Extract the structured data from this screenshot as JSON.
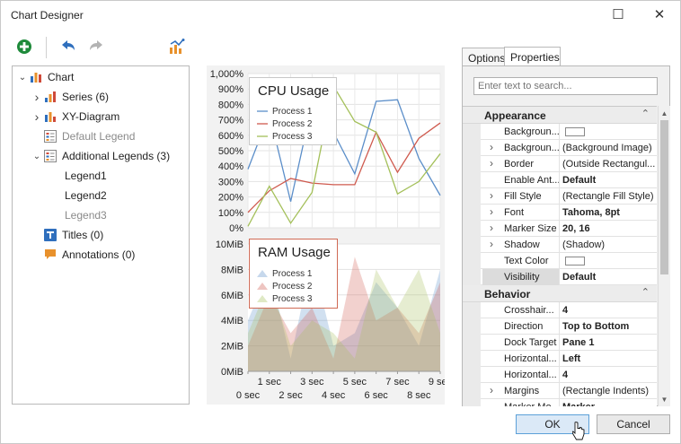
{
  "window": {
    "title": "Chart Designer",
    "maximize_glyph": "☐",
    "close_glyph": "✕"
  },
  "toolbar": {
    "add_icon": "plus-circle-icon",
    "undo_icon": "undo-icon",
    "redo_icon": "redo-icon",
    "chart_wizard_icon": "chart-wizard-icon"
  },
  "tree": {
    "items": [
      {
        "label": "Chart",
        "arrow": "⌄",
        "icon": "chart-icon"
      },
      {
        "label": "Series (6)",
        "arrow": "›",
        "icon": "series-icon"
      },
      {
        "label": "XY-Diagram",
        "arrow": "›",
        "icon": "diagram-icon"
      },
      {
        "label": "Default Legend",
        "arrow": "",
        "icon": "legend-icon"
      },
      {
        "label": "Additional Legends (3)",
        "arrow": "⌄",
        "icon": "legend-icon"
      },
      {
        "label": "Legend1",
        "arrow": "",
        "icon": ""
      },
      {
        "label": "Legend2",
        "arrow": "",
        "icon": ""
      },
      {
        "label": "Legend3",
        "arrow": "",
        "icon": ""
      },
      {
        "label": "Titles (0)",
        "arrow": "",
        "icon": "titles-icon"
      },
      {
        "label": "Annotations (0)",
        "arrow": "",
        "icon": "annotations-icon"
      }
    ]
  },
  "tabs": {
    "options": "Options",
    "properties": "Properties"
  },
  "search": {
    "placeholder": "Enter text to search..."
  },
  "properties": {
    "appearance_label": "Appearance",
    "behavior_label": "Behavior",
    "collapse_glyph": "⌃",
    "appearance_rows": [
      {
        "name": "Backgroun...",
        "value": "",
        "expander": "",
        "swatch": true,
        "bold": false
      },
      {
        "name": "Backgroun...",
        "value": "(Background Image)",
        "expander": "›",
        "swatch": false,
        "bold": false
      },
      {
        "name": "Border",
        "value": "(Outside Rectangul...",
        "expander": "›",
        "swatch": false,
        "bold": false
      },
      {
        "name": "Enable Ant...",
        "value": "Default",
        "expander": "",
        "swatch": false,
        "bold": true
      },
      {
        "name": "Fill Style",
        "value": "(Rectangle Fill Style)",
        "expander": "›",
        "swatch": false,
        "bold": false
      },
      {
        "name": "Font",
        "value": "Tahoma, 8pt",
        "expander": "›",
        "swatch": false,
        "bold": true
      },
      {
        "name": "Marker Size",
        "value": "20, 16",
        "expander": "›",
        "swatch": false,
        "bold": true
      },
      {
        "name": "Shadow",
        "value": "(Shadow)",
        "expander": "›",
        "swatch": false,
        "bold": false
      },
      {
        "name": "Text Color",
        "value": "",
        "expander": "",
        "swatch": true,
        "bold": false
      },
      {
        "name": "Visibility",
        "value": "Default",
        "expander": "",
        "swatch": false,
        "bold": true
      }
    ],
    "behavior_rows": [
      {
        "name": "Crosshair...",
        "value": "4",
        "expander": "",
        "swatch": false,
        "bold": true
      },
      {
        "name": "Direction",
        "value": "Top to Bottom",
        "expander": "",
        "swatch": false,
        "bold": true
      },
      {
        "name": "Dock Target",
        "value": "Pane 1",
        "expander": "",
        "swatch": false,
        "bold": true
      },
      {
        "name": "Horizontal...",
        "value": "Left",
        "expander": "",
        "swatch": false,
        "bold": true
      },
      {
        "name": "Horizontal...",
        "value": "4",
        "expander": "",
        "swatch": false,
        "bold": true
      },
      {
        "name": "Margins",
        "value": "(Rectangle Indents)",
        "expander": "›",
        "swatch": false,
        "bold": false
      },
      {
        "name": "Marker Mo...",
        "value": "Marker",
        "expander": "",
        "swatch": false,
        "bold": true
      }
    ]
  },
  "buttons": {
    "ok": "OK",
    "cancel": "Cancel"
  },
  "colors": {
    "process1": "#5b8ec9",
    "process2": "#cf5a4e",
    "process3": "#a4c05a",
    "accent": "#5ca0d8"
  },
  "chart_data": [
    {
      "type": "line",
      "title": "CPU Usage",
      "ylim": [
        0,
        1000
      ],
      "y_ticks": [
        "0%",
        "100%",
        "200%",
        "300%",
        "400%",
        "500%",
        "600%",
        "700%",
        "800%",
        "900%",
        "1,000%"
      ],
      "x": [
        0,
        1,
        2,
        3,
        4,
        5,
        6,
        7,
        8,
        9
      ],
      "series": [
        {
          "name": "Process 1",
          "values": [
            380,
            740,
            170,
            800,
            620,
            350,
            820,
            830,
            450,
            210
          ]
        },
        {
          "name": "Process 2",
          "values": [
            100,
            240,
            320,
            290,
            280,
            280,
            620,
            360,
            580,
            680
          ]
        },
        {
          "name": "Process 3",
          "values": [
            10,
            270,
            30,
            230,
            920,
            690,
            620,
            220,
            300,
            480
          ]
        }
      ]
    },
    {
      "type": "area",
      "title": "RAM Usage",
      "ylim": [
        0,
        10
      ],
      "y_ticks": [
        "0MiB",
        "2MiB",
        "4MiB",
        "6MiB",
        "8MiB",
        "10MiB"
      ],
      "x": [
        0,
        1,
        2,
        3,
        4,
        5,
        6,
        7,
        8,
        9
      ],
      "x_ticks_top": [
        "1 sec",
        "3 sec",
        "5 sec",
        "7 sec",
        "9 sec"
      ],
      "x_ticks_bottom": [
        "0 sec",
        "2 sec",
        "4 sec",
        "6 sec",
        "8 sec"
      ],
      "series": [
        {
          "name": "Process 1",
          "values": [
            4,
            8,
            1,
            9,
            2,
            3,
            7,
            5,
            2,
            8
          ]
        },
        {
          "name": "Process 2",
          "values": [
            2,
            6,
            3,
            5,
            1,
            9,
            4,
            5,
            3,
            7
          ]
        },
        {
          "name": "Process 3",
          "values": [
            3,
            7,
            2,
            4,
            3,
            1,
            8,
            5,
            8,
            3
          ]
        }
      ]
    }
  ]
}
